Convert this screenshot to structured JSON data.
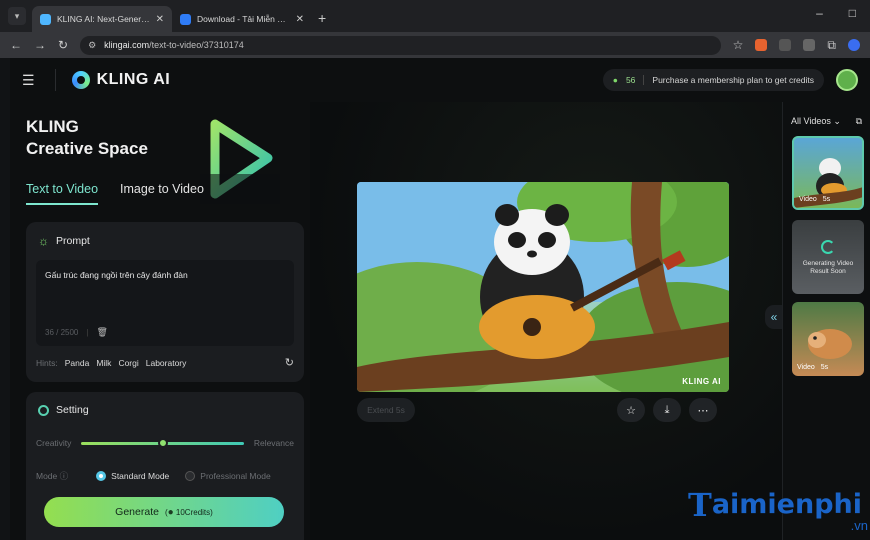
{
  "browser": {
    "tabs": [
      {
        "title": "KLING AI: Next-Generation AI C",
        "active": true,
        "favicon_color": "#4fb7ff"
      },
      {
        "title": "Download - Tải Miễn Phí VN - ",
        "active": false,
        "favicon_color": "#2f7cf6"
      }
    ],
    "url_host": "klingai.com",
    "url_path": "/text-to-video/37310174"
  },
  "header": {
    "logo_text": "KLING AI",
    "credits_count": "56",
    "membership_text": "Purchase a membership plan to get credits"
  },
  "left": {
    "hero_line1": "KLING",
    "hero_line2": "Creative Space",
    "tabs": [
      "Text to Video",
      "Image to Video"
    ],
    "prompt_title": "Prompt",
    "prompt_text": "Gấu trúc đang ngồi trên cây đánh đàn",
    "char_count": "36 / 2500",
    "hints_label": "Hints:",
    "hints": [
      "Panda",
      "Milk",
      "Corgi",
      "Laboratory"
    ],
    "setting_title": "Setting",
    "creativity_label": "Creativity",
    "relevance_label": "Relevance",
    "slider_value": 0.5,
    "mode_label": "Mode",
    "mode_options": [
      "Standard Mode",
      "Professional Mode"
    ],
    "generate_label": "Generate",
    "generate_credits": "10Credits"
  },
  "center": {
    "watermark": "KLING AI",
    "extend_label": "Extend 5s"
  },
  "rail": {
    "title": "All Videos",
    "items": [
      {
        "type": "Video",
        "duration": "5s"
      },
      {
        "status": "Generating Video Result Soon"
      },
      {
        "type": "Video",
        "duration": "5s"
      }
    ]
  },
  "site_brand": {
    "initial": "T",
    "rest": "aimienphi",
    "tld": ".vn"
  }
}
